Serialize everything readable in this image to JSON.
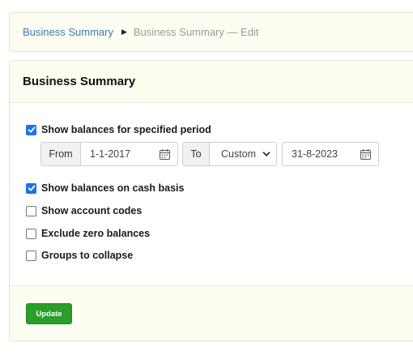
{
  "breadcrumb": {
    "link": "Business Summary",
    "separator_icon": "triangle-right-icon",
    "current": "Business Summary — Edit"
  },
  "panel": {
    "title": "Business Summary"
  },
  "options": {
    "specified_period": {
      "label": "Show balances for specified period",
      "checked": true
    },
    "cash_basis": {
      "label": "Show balances on cash basis",
      "checked": true
    },
    "account_codes": {
      "label": "Show account codes",
      "checked": false
    },
    "exclude_zero": {
      "label": "Exclude zero balances",
      "checked": false
    },
    "collapse_groups": {
      "label": "Groups to collapse",
      "checked": false
    }
  },
  "period": {
    "from_label": "From",
    "from_value": "1-1-2017",
    "to_label": "To",
    "to_mode": "Custom",
    "to_value": "31-8-2023"
  },
  "actions": {
    "update_label": "Update"
  },
  "colors": {
    "accent": "#1a73e8",
    "link": "#3a7bb8",
    "button": "#2a9d2a",
    "panel_bg": "#fdfdf2"
  }
}
